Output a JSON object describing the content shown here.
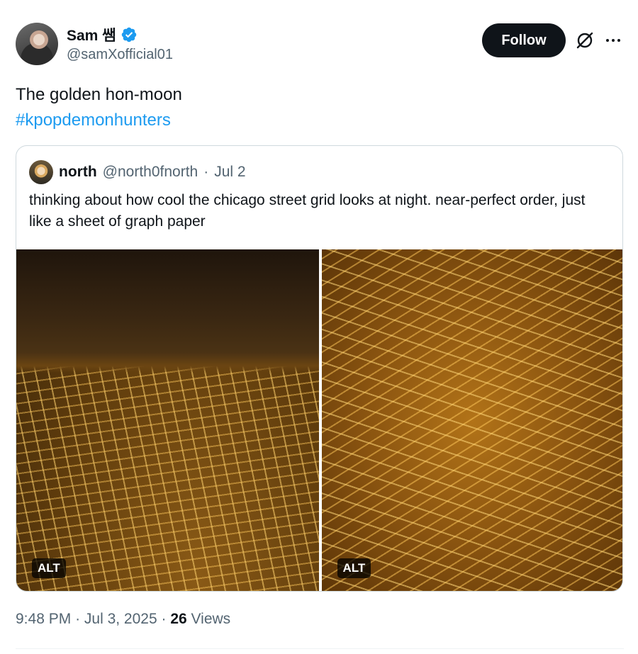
{
  "author": {
    "display_name": "Sam 쌤",
    "handle": "@samXofficial01",
    "avatar_icon": "profile-photo",
    "verified_icon": "verified-badge-icon"
  },
  "actions": {
    "follow_label": "Follow",
    "grok_icon": "grok-icon",
    "more_icon": "more-dots-icon"
  },
  "tweet": {
    "text": "The golden hon-moon",
    "hashtag": "#kpopdemonhunters"
  },
  "quote": {
    "name": "north",
    "handle": "@north0fnorth",
    "separator": "·",
    "date": "Jul 2",
    "text": "thinking about how cool the chicago street grid looks at night. near-perfect order, just like a sheet of graph paper",
    "media": [
      {
        "alt_label": "ALT"
      },
      {
        "alt_label": "ALT"
      }
    ]
  },
  "meta": {
    "time": "9:48 PM",
    "sep1": "·",
    "date": "Jul 3, 2025",
    "sep2": "·",
    "views_count": "26",
    "views_label": "Views"
  },
  "colors": {
    "link": "#1d9bf0",
    "muted": "#536471",
    "text": "#0f1419"
  }
}
